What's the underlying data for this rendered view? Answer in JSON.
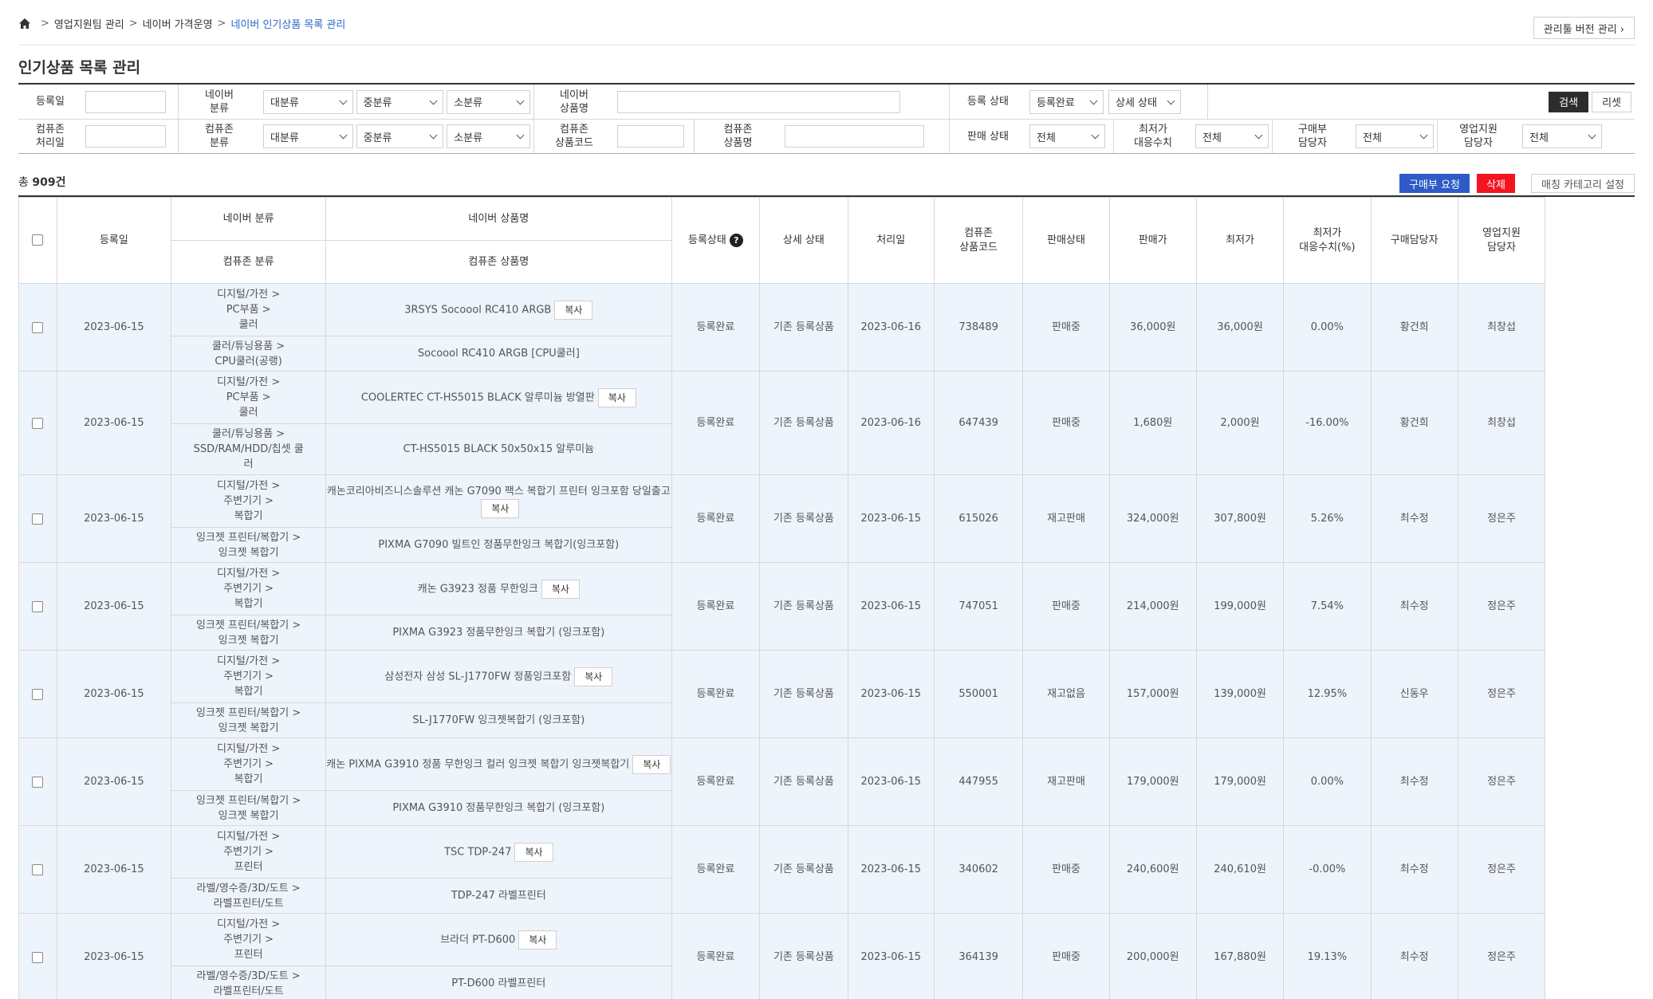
{
  "breadcrumb": {
    "items": [
      "영업지원팀 관리",
      "네이버 가격운영"
    ],
    "current": "네이버 인기상품 목록 관리",
    "home_icon": "home-icon"
  },
  "version_button": "관리툴 버전 관리 ›",
  "page_title": "인기상품 목록 관리",
  "filters": {
    "reg_date_label": "등록일",
    "naver_category_label": "네이버\n분류",
    "naver_name_label": "네이버\n상품명",
    "reg_status_label": "등록 상태",
    "reg_status_value": "등록완료",
    "detail_status_value": "상세 상태",
    "search_button": "검색",
    "reset_button": "리셋",
    "proc_date_label": "컴퓨존\n처리일",
    "cz_category_label": "컴퓨존\n분류",
    "cz_code_label": "컴퓨존\n상품코드",
    "cz_name_label": "컴퓨존\n상품명",
    "sale_status_label": "판매 상태",
    "sale_status_value": "전체",
    "lowest_label": "최저가\n대응수치",
    "lowest_value": "전체",
    "buyer_label": "구매부\n담당자",
    "buyer_value": "전체",
    "sales_label": "영업지원\n담당자",
    "sales_value": "전체",
    "cat_large": "대분류",
    "cat_mid": "중분류",
    "cat_small": "소분류"
  },
  "summary": {
    "prefix": "총 ",
    "count": "909건"
  },
  "action_buttons": {
    "purchase_request": "구매부 요청",
    "delete": "삭제",
    "matching_category": "매칭 카테고리 설정"
  },
  "table": {
    "headers": {
      "reg_date": "등록일",
      "naver_category": "네이버 분류",
      "naver_name": "네이버 상품명",
      "cz_category": "컴퓨존 분류",
      "cz_name": "컴퓨존 상품명",
      "reg_status": "등록상태",
      "detail_status": "상세 상태",
      "proc_date": "처리일",
      "cz_code": "컴퓨존\n상품코드",
      "sale_status": "판매상태",
      "price": "판매가",
      "lowest": "최저가",
      "lowest_ratio": "최저가\n대응수치(%)",
      "buyer": "구매담당자",
      "sales": "영업지원\n담당자"
    },
    "copy_label": "복사",
    "rows": [
      {
        "date": "2023-06-15",
        "naver_cat": "디지털/가전 >\nPC부품 >\n쿨러",
        "naver_name": "3RSYS Socoool RC410 ARGB",
        "cz_cat": "쿨러/튜닝용품 >\nCPU쿨러(공랭)",
        "cz_name": "Socoool RC410 ARGB [CPU쿨러]",
        "status": "등록완료",
        "detail": "기존 등록상품",
        "proc": "2023-06-16",
        "code": "738489",
        "sale": "판매중",
        "price": "36,000원",
        "lowest": "36,000원",
        "ratio": "0.00%",
        "buyer": "황건희",
        "sales": "최창섭"
      },
      {
        "date": "2023-06-15",
        "naver_cat": "디지털/가전 >\nPC부품 >\n쿨러",
        "naver_name": "COOLERTEC CT-HS5015 BLACK 알루미늄 방열판",
        "cz_cat": "쿨러/튜닝용품 >\nSSD/RAM/HDD/칩셋 쿨\n러",
        "cz_name": "CT-HS5015 BLACK 50x50x15 알루미늄",
        "status": "등록완료",
        "detail": "기존 등록상품",
        "proc": "2023-06-16",
        "code": "647439",
        "sale": "판매중",
        "price": "1,680원",
        "lowest": "2,000원",
        "ratio": "-16.00%",
        "buyer": "황건희",
        "sales": "최창섭"
      },
      {
        "date": "2023-06-15",
        "naver_cat": "디지털/가전 >\n주변기기 >\n복합기",
        "naver_name": "캐논코리아비즈니스솔루션 캐논 G7090 팩스 복합기 프린터 잉크포함 당일출고",
        "cz_cat": "잉크젯 프린터/복합기 >\n잉크젯 복합기",
        "cz_name": "PIXMA G7090 빌트인 정품무한잉크 복합기(잉크포함)",
        "status": "등록완료",
        "detail": "기존 등록상품",
        "proc": "2023-06-15",
        "code": "615026",
        "sale": "재고판매",
        "price": "324,000원",
        "lowest": "307,800원",
        "ratio": "5.26%",
        "buyer": "최수정",
        "sales": "정은주"
      },
      {
        "date": "2023-06-15",
        "naver_cat": "디지털/가전 >\n주변기기 >\n복합기",
        "naver_name": "캐논 G3923 정품 무한잉크",
        "cz_cat": "잉크젯 프린터/복합기 >\n잉크젯 복합기",
        "cz_name": "PIXMA G3923 정품무한잉크 복합기 (잉크포함)",
        "status": "등록완료",
        "detail": "기존 등록상품",
        "proc": "2023-06-15",
        "code": "747051",
        "sale": "판매중",
        "price": "214,000원",
        "lowest": "199,000원",
        "ratio": "7.54%",
        "buyer": "최수정",
        "sales": "정은주"
      },
      {
        "date": "2023-06-15",
        "naver_cat": "디지털/가전 >\n주변기기 >\n복합기",
        "naver_name": "삼성전자 삼성 SL-J1770FW 정품잉크포함",
        "cz_cat": "잉크젯 프린터/복합기 >\n잉크젯 복합기",
        "cz_name": "SL-J1770FW 잉크젯복합기 (잉크포함)",
        "status": "등록완료",
        "detail": "기존 등록상품",
        "proc": "2023-06-15",
        "code": "550001",
        "sale": "재고없음",
        "price": "157,000원",
        "lowest": "139,000원",
        "ratio": "12.95%",
        "buyer": "신동우",
        "sales": "정은주"
      },
      {
        "date": "2023-06-15",
        "naver_cat": "디지털/가전 >\n주변기기 >\n복합기",
        "naver_name": "캐논 PIXMA G3910 정품 무한잉크 컬러 잉크젯 복합기 잉크젯복합기",
        "cz_cat": "잉크젯 프린터/복합기 >\n잉크젯 복합기",
        "cz_name": "PIXMA G3910 정품무한잉크 복합기 (잉크포함)",
        "status": "등록완료",
        "detail": "기존 등록상품",
        "proc": "2023-06-15",
        "code": "447955",
        "sale": "재고판매",
        "price": "179,000원",
        "lowest": "179,000원",
        "ratio": "0.00%",
        "buyer": "최수정",
        "sales": "정은주"
      },
      {
        "date": "2023-06-15",
        "naver_cat": "디지털/가전 >\n주변기기 >\n프린터",
        "naver_name": "TSC TDP-247",
        "cz_cat": "라벨/영수증/3D/도트 >\n라벨프린터/도트",
        "cz_name": "TDP-247 라벨프린터",
        "status": "등록완료",
        "detail": "기존 등록상품",
        "proc": "2023-06-15",
        "code": "340602",
        "sale": "판매중",
        "price": "240,600원",
        "lowest": "240,610원",
        "ratio": "-0.00%",
        "buyer": "최수정",
        "sales": "정은주"
      },
      {
        "date": "2023-06-15",
        "naver_cat": "디지털/가전 >\n주변기기 >\n프린터",
        "naver_name": "브라더 PT-D600",
        "cz_cat": "라벨/영수증/3D/도트 >\n라벨프린터/도트",
        "cz_name": "PT-D600 라벨프린터",
        "status": "등록완료",
        "detail": "기존 등록상품",
        "proc": "2023-06-15",
        "code": "364139",
        "sale": "판매중",
        "price": "200,000원",
        "lowest": "167,880원",
        "ratio": "19.13%",
        "buyer": "최수정",
        "sales": "정은주"
      }
    ]
  },
  "colors": {
    "accent": "#2a67c9",
    "blue_button": "#2e5bc7",
    "red_button": "#f4141f",
    "row_bg": "#eef4fb"
  }
}
